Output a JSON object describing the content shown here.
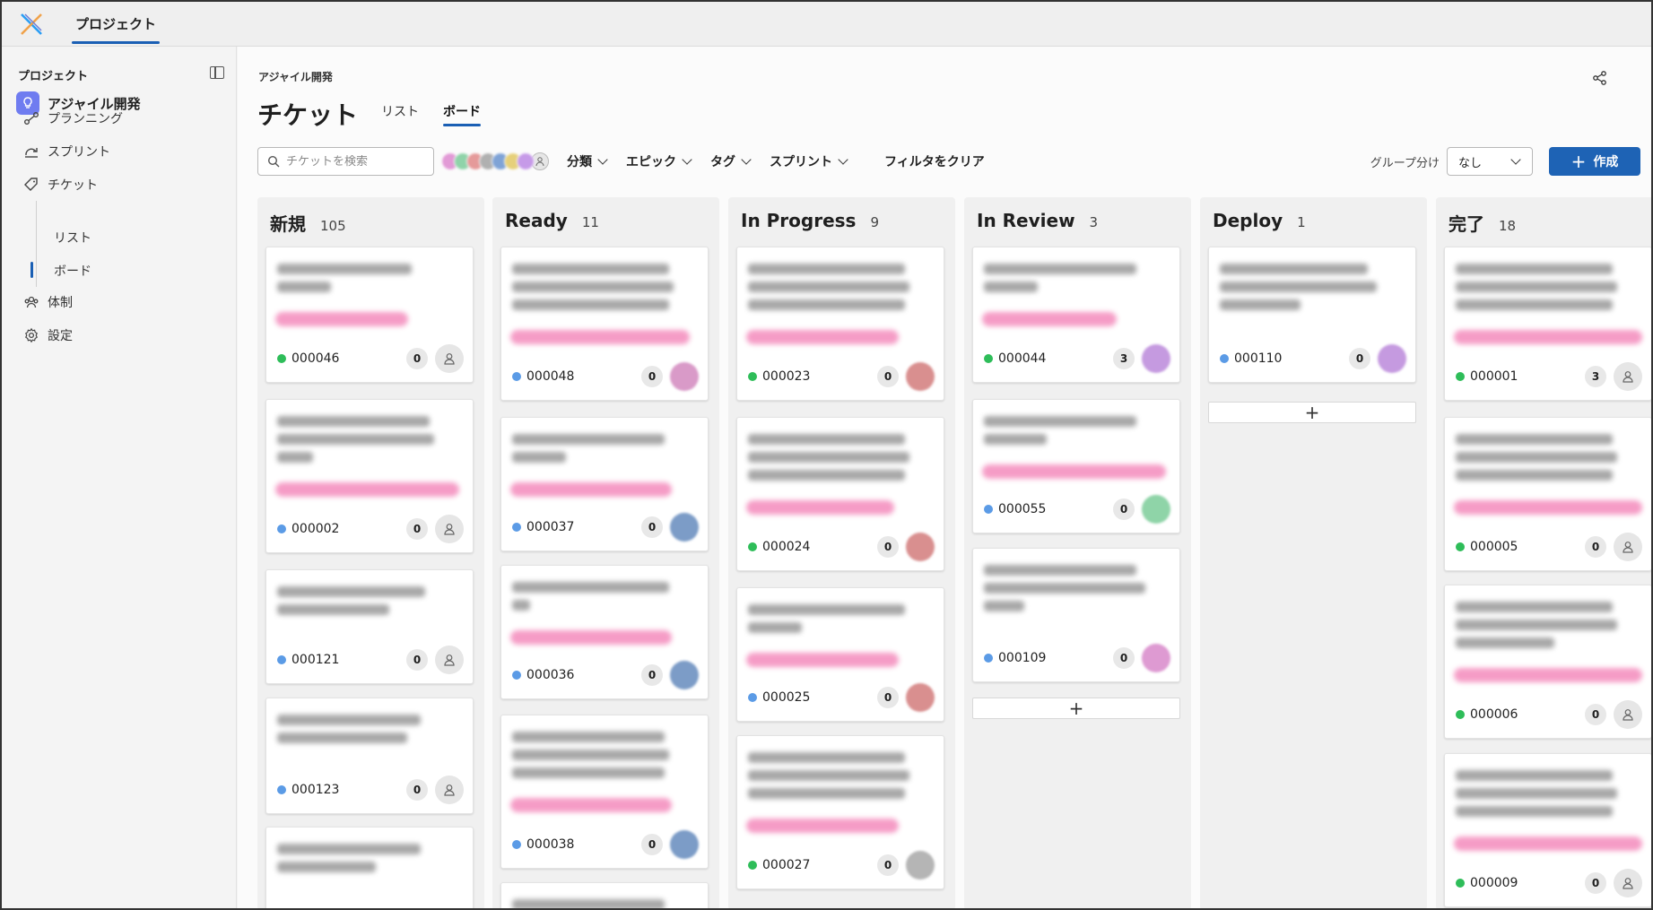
{
  "app": {
    "top_tab": "プロジェクト"
  },
  "sidebar": {
    "header": "プロジェクト",
    "project": "アジャイル開発",
    "items": [
      {
        "label": "プランニング",
        "icon": "planning-icon"
      },
      {
        "label": "スプリント",
        "icon": "sprint-icon"
      },
      {
        "label": "チケット",
        "icon": "ticket-icon"
      },
      {
        "label": "体制",
        "icon": "team-icon"
      },
      {
        "label": "設定",
        "icon": "settings-icon"
      }
    ],
    "sub_items": [
      {
        "label": "リスト"
      },
      {
        "label": "ボード"
      }
    ]
  },
  "main": {
    "breadcrumb": "アジャイル開発",
    "title": "チケット",
    "tabs": [
      {
        "label": "リスト"
      },
      {
        "label": "ボード"
      }
    ],
    "active_tab": "ボード",
    "search_placeholder": "チケットを検索",
    "filters": [
      "分類",
      "エピック",
      "タグ",
      "スプリント"
    ],
    "clear_filter": "フィルタをクリア",
    "group_label": "グループ分け",
    "group_value": "なし",
    "create_label": "作成"
  },
  "colors": {
    "accent": "#1e63b5",
    "status_green": "#2ebd59",
    "status_blue": "#5b9be6",
    "filter_avatars": [
      "#e29ad6",
      "#8fd3a9",
      "#e59a9a",
      "#b0b0b0",
      "#7fa3d6",
      "#e6d07a",
      "#c69ae8"
    ]
  },
  "columns": [
    {
      "title": "新規",
      "count": "105",
      "cards": [
        {
          "id": "000046",
          "status": "green",
          "comments": "0",
          "assignee_color": ""
        },
        {
          "id": "000002",
          "status": "blue",
          "comments": "0",
          "assignee_color": ""
        },
        {
          "id": "000121",
          "status": "blue",
          "comments": "0",
          "assignee_color": ""
        },
        {
          "id": "000123",
          "status": "blue",
          "comments": "0",
          "assignee_color": ""
        }
      ]
    },
    {
      "title": "Ready",
      "count": "11",
      "cards": [
        {
          "id": "000048",
          "status": "blue",
          "comments": "0",
          "assignee_color": "#d99ac8"
        },
        {
          "id": "000037",
          "status": "blue",
          "comments": "0",
          "assignee_color": "#7c9cc7"
        },
        {
          "id": "000036",
          "status": "blue",
          "comments": "0",
          "assignee_color": "#7c9cc7"
        },
        {
          "id": "000038",
          "status": "blue",
          "comments": "0",
          "assignee_color": "#7c9cc7"
        }
      ]
    },
    {
      "title": "In Progress",
      "count": "9",
      "cards": [
        {
          "id": "000023",
          "status": "green",
          "comments": "0",
          "assignee_color": "#d98f8f"
        },
        {
          "id": "000024",
          "status": "green",
          "comments": "0",
          "assignee_color": "#d98f8f"
        },
        {
          "id": "000025",
          "status": "blue",
          "comments": "0",
          "assignee_color": "#d98f8f"
        },
        {
          "id": "000027",
          "status": "green",
          "comments": "0",
          "assignee_color": "#b5b5b5"
        }
      ]
    },
    {
      "title": "In Review",
      "count": "3",
      "cards": [
        {
          "id": "000044",
          "status": "green",
          "comments": "3",
          "assignee_color": "#c59ae0"
        },
        {
          "id": "000055",
          "status": "blue",
          "comments": "0",
          "assignee_color": "#8fd4a8"
        },
        {
          "id": "000109",
          "status": "blue",
          "comments": "0",
          "assignee_color": "#de9ad2"
        }
      ]
    },
    {
      "title": "Deploy",
      "count": "1",
      "cards": [
        {
          "id": "000110",
          "status": "blue",
          "comments": "0",
          "assignee_color": "#c59ae0"
        }
      ]
    },
    {
      "title": "完了",
      "count": "18",
      "cards": [
        {
          "id": "000001",
          "status": "green",
          "comments": "3",
          "assignee_color": ""
        },
        {
          "id": "000005",
          "status": "green",
          "comments": "0",
          "assignee_color": ""
        },
        {
          "id": "000006",
          "status": "green",
          "comments": "0",
          "assignee_color": ""
        },
        {
          "id": "000009",
          "status": "green",
          "comments": "0",
          "assignee_color": ""
        }
      ]
    }
  ]
}
